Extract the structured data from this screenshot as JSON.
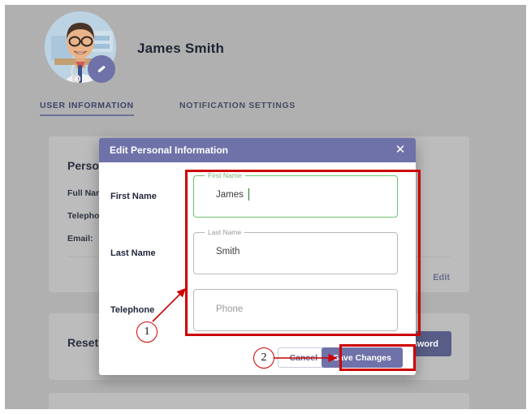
{
  "profile": {
    "user_name": "James Smith",
    "avatar_alt": "doctor-avatar",
    "edit_badge_icon": "pencil-icon"
  },
  "tabs": [
    {
      "label": "USER INFORMATION",
      "active": true
    },
    {
      "label": "NOTIFICATION SETTINGS",
      "active": false
    }
  ],
  "personal_card": {
    "title": "Personal Information",
    "full_name_label": "Full Name:",
    "telephone_label": "Telephone:",
    "email_label": "Email:",
    "edit_link": "Edit"
  },
  "reset_card": {
    "title": "Reset Password",
    "button_label": "Reset Password"
  },
  "modal": {
    "title": "Edit Personal Information",
    "close_icon": "close-icon",
    "fields": [
      {
        "label": "First Name",
        "float_label": "First Name",
        "value": "James",
        "placeholder": "",
        "focused": true
      },
      {
        "label": "Last Name",
        "float_label": "Last Name",
        "value": "Smith",
        "placeholder": "",
        "focused": false
      },
      {
        "label": "Telephone",
        "float_label": "",
        "value": "",
        "placeholder": "Phone",
        "focused": false
      }
    ],
    "cancel_label": "Cancel",
    "save_label": "Save Changes"
  },
  "annotations": [
    {
      "number": "1",
      "target": "form-fields-highlight"
    },
    {
      "number": "2",
      "target": "save-changes-highlight"
    }
  ],
  "colors": {
    "accent_purple": "#6f72a8",
    "reset_button": "#585d87",
    "annotation_red": "#cc0000",
    "focus_green": "#6cc06c",
    "page_background": "#b0b0b0",
    "card_background": "#bcbcbc"
  }
}
